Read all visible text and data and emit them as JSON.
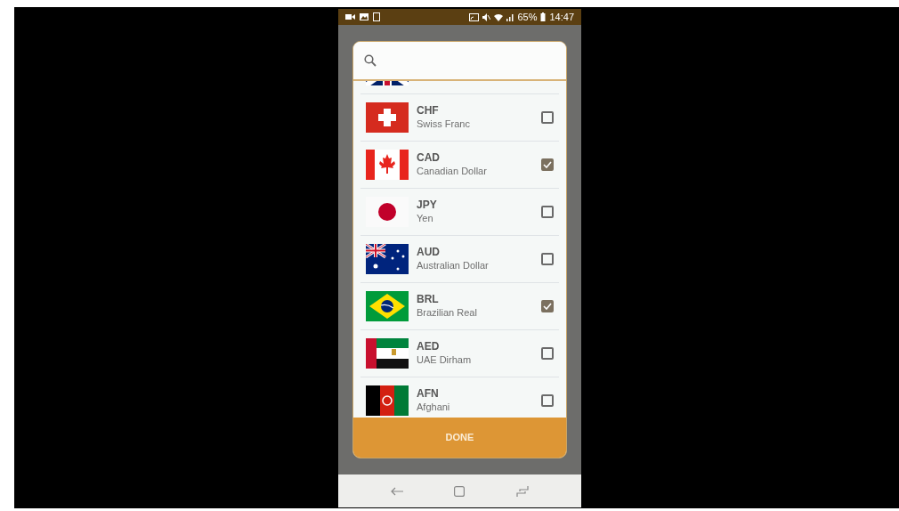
{
  "status_bar": {
    "battery": "65%",
    "time": "14:47"
  },
  "dialog": {
    "currencies": [
      {
        "kind": "ch",
        "code": "CHF",
        "name": "Swiss Franc",
        "checked": false
      },
      {
        "kind": "ca",
        "code": "CAD",
        "name": "Canadian Dollar",
        "checked": true
      },
      {
        "kind": "jp",
        "code": "JPY",
        "name": "Yen",
        "checked": false
      },
      {
        "kind": "au",
        "code": "AUD",
        "name": "Australian Dollar",
        "checked": false
      },
      {
        "kind": "br",
        "code": "BRL",
        "name": "Brazilian Real",
        "checked": true
      },
      {
        "kind": "ae",
        "code": "AED",
        "name": "UAE Dirham",
        "checked": false
      },
      {
        "kind": "af",
        "code": "AFN",
        "name": "Afghani",
        "checked": false
      }
    ],
    "done_button": "DONE"
  }
}
